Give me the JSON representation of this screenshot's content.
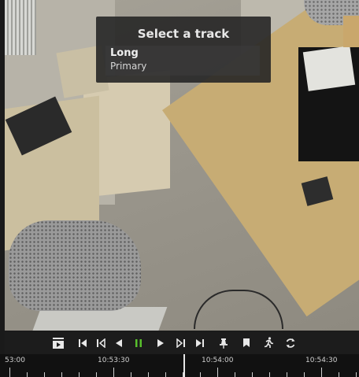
{
  "track_popup": {
    "title": "Select a track",
    "tracks": [
      {
        "name": "Long",
        "subtitle": "Primary"
      }
    ]
  },
  "controls": {
    "buttons": [
      {
        "name": "video-source-icon"
      },
      {
        "name": "skip-to-start-icon"
      },
      {
        "name": "step-back-icon"
      },
      {
        "name": "play-backward-icon"
      },
      {
        "name": "pause-icon",
        "color": "#58c02c"
      },
      {
        "name": "play-forward-icon"
      },
      {
        "name": "step-forward-icon"
      },
      {
        "name": "skip-to-end-icon"
      },
      {
        "name": "pin-icon"
      },
      {
        "name": "bookmark-icon"
      },
      {
        "name": "motion-icon"
      },
      {
        "name": "sync-icon"
      }
    ]
  },
  "timeline": {
    "labels": [
      "53:00",
      "10:53:30",
      "10:54:00",
      "10:54:30"
    ]
  }
}
